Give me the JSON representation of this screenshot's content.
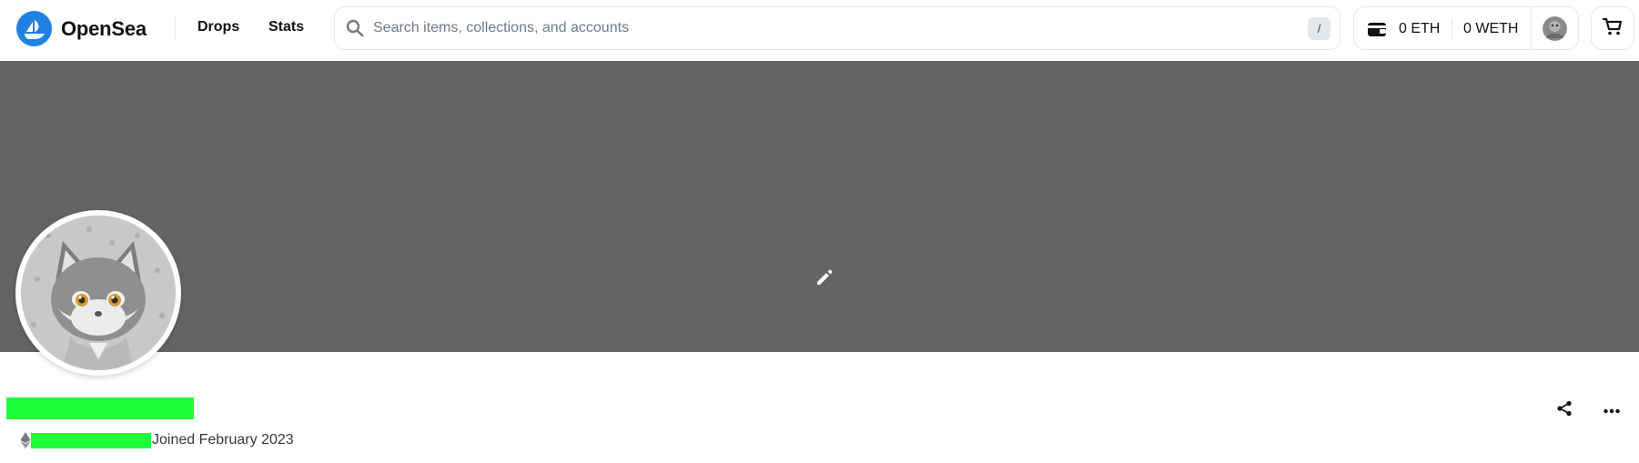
{
  "header": {
    "brand": "OpenSea",
    "nav": [
      {
        "label": "Drops"
      },
      {
        "label": "Stats"
      }
    ],
    "search": {
      "placeholder": "Search items, collections, and accounts",
      "shortcut_key": "/"
    },
    "wallet": {
      "eth_balance": "0 ETH",
      "weth_balance": "0 WETH"
    }
  },
  "profile": {
    "joined": "Joined February 2023"
  },
  "icons": {
    "search": "search-icon",
    "wallet": "wallet-icon",
    "cart": "cart-icon",
    "edit": "pencil-icon",
    "share": "share-icon",
    "more": "more-horizontal-icon",
    "chain": "ethereum-icon"
  },
  "colors": {
    "brand_blue": "#2081e2",
    "banner": "#636564",
    "redaction": "#1fff3a"
  }
}
